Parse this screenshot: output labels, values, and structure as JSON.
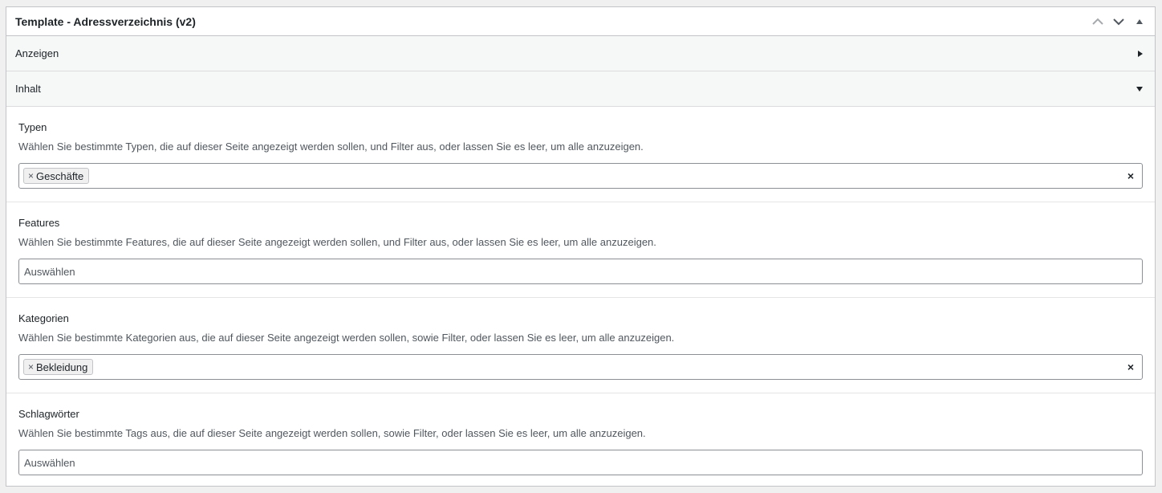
{
  "panel": {
    "title": "Template - Adressverzeichnis (v2)",
    "controls": [
      "move-up-icon",
      "move-down-icon",
      "collapse-panel-icon"
    ]
  },
  "sections": [
    {
      "label": "Anzeigen",
      "state": "collapsed",
      "toggle_icon": "triangle-right-icon"
    },
    {
      "label": "Inhalt",
      "state": "expanded",
      "toggle_icon": "triangle-down-icon"
    }
  ],
  "fields": {
    "typen": {
      "label": "Typen",
      "description": "Wählen Sie bestimmte Typen, die auf dieser Seite angezeigt werden sollen, und Filter aus, oder lassen Sie es leer, um alle anzuzeigen.",
      "tags": [
        "Geschäfte"
      ],
      "tag_remove": "×",
      "clear": "×"
    },
    "features": {
      "label": "Features",
      "description": "Wählen Sie bestimmte Features, die auf dieser Seite angezeigt werden sollen, und Filter aus, oder lassen Sie es leer, um alle anzuzeigen.",
      "placeholder": "Auswählen"
    },
    "kategorien": {
      "label": "Kategorien",
      "description": "Wählen Sie bestimmte Kategorien aus, die auf dieser Seite angezeigt werden sollen, sowie Filter, oder lassen Sie es leer, um alle anzuzeigen.",
      "tags": [
        "Bekleidung"
      ],
      "tag_remove": "×",
      "clear": "×"
    },
    "schlagwoerter": {
      "label": "Schlagwörter",
      "description": "Wählen Sie bestimmte Tags aus, die auf dieser Seite angezeigt werden sollen, sowie Filter, oder lassen Sie es leer, um alle anzuzeigen.",
      "placeholder": "Auswählen"
    }
  }
}
